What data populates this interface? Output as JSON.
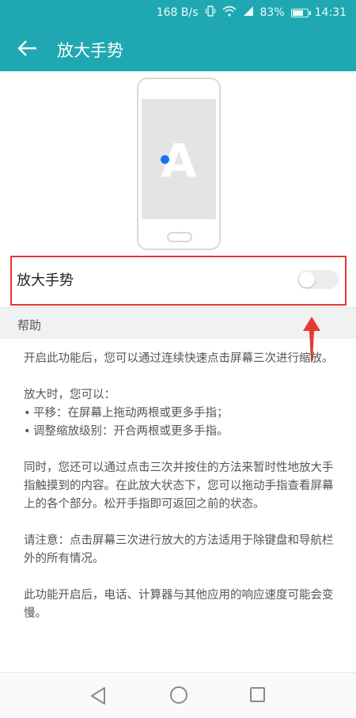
{
  "status_bar": {
    "net_speed": "168 B/s",
    "icons": [
      "vibrate-icon",
      "wifi-icon",
      "signal-icon"
    ],
    "battery": "83%",
    "battery_level": 0.83,
    "time": "14:31"
  },
  "app_bar": {
    "back_icon": "back-arrow-icon",
    "title": "放大手势"
  },
  "illustration": {
    "letter": "A"
  },
  "toggle": {
    "label": "放大手势",
    "state": "off"
  },
  "help": {
    "title": "帮助",
    "p1": "开启此功能后，您可以通过连续快速点击屏幕三次进行缩放。",
    "p2_intro": "放大时，您可以：",
    "bullet1": "平移：在屏幕上拖动两根或更多手指；",
    "bullet2": "调整缩放级别：开合两根或更多手指。",
    "p3": "同时，您还可以通过点击三次并按住的方法来暂时性地放大手指触摸到的内容。在此放大状态下，您可以拖动手指查看屏幕上的各个部分。松开手指即可返回之前的状态。",
    "p4": "请注意：点击屏幕三次进行放大的方法适用于除键盘和导航栏外的所有情况。",
    "p5": "此功能开启后，电话、计算器与其他应用的响应速度可能会变慢。"
  },
  "bullet_char": "•",
  "colors": {
    "header": "#1fa8b2",
    "highlight": "#e53935",
    "tap_dot": "#1a73e8"
  },
  "nav": {
    "icons": [
      "back-triangle-icon",
      "home-circle-icon",
      "recents-square-icon"
    ]
  }
}
